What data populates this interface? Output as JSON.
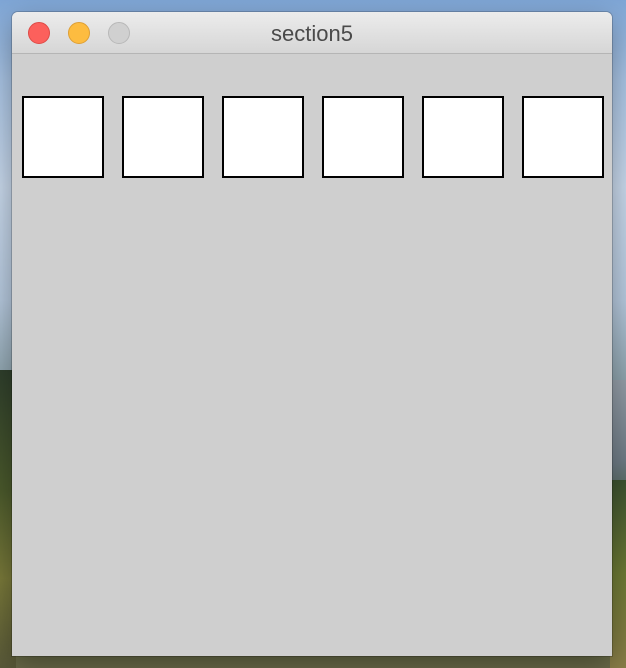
{
  "window": {
    "title": "section5"
  },
  "titlebar": {
    "buttons": [
      {
        "name": "close",
        "color": "#fc605c"
      },
      {
        "name": "minimize",
        "color": "#fdbc40"
      },
      {
        "name": "zoom",
        "color": "#d0d0d0",
        "state": "disabled"
      }
    ]
  },
  "content": {
    "background": "#cfcfcf",
    "squares": [
      {
        "fill": "#ffffff",
        "border": "#000000"
      },
      {
        "fill": "#ffffff",
        "border": "#000000"
      },
      {
        "fill": "#ffffff",
        "border": "#000000"
      },
      {
        "fill": "#ffffff",
        "border": "#000000"
      },
      {
        "fill": "#ffffff",
        "border": "#000000"
      },
      {
        "fill": "#ffffff",
        "border": "#000000"
      }
    ]
  }
}
